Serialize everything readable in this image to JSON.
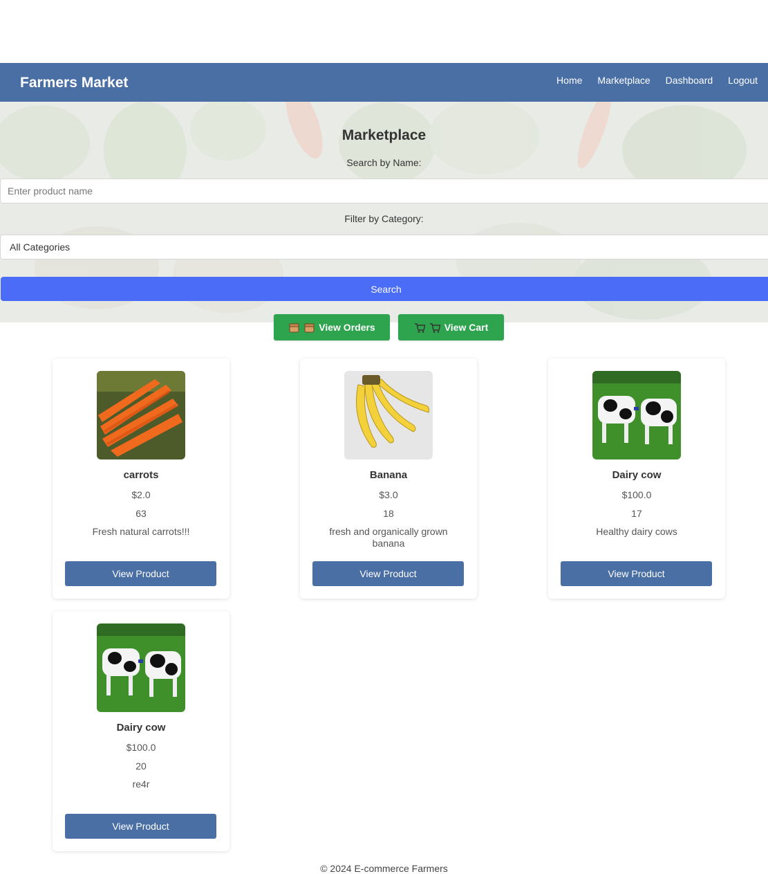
{
  "navbar": {
    "brand": "Farmers Market",
    "links": [
      "Home",
      "Marketplace",
      "Dashboard",
      "Logout"
    ]
  },
  "marketplace": {
    "title": "Marketplace",
    "search_label": "Search by Name:",
    "search_placeholder": "Enter product name",
    "category_label": "Filter by Category:",
    "category_selected": "All Categories",
    "search_button": "Search"
  },
  "actions": {
    "orders_label": "View Orders",
    "orders_icon": "box-icon",
    "cart_label": "View Cart",
    "cart_icon": "cart-icon"
  },
  "products": [
    {
      "name": "carrots",
      "price": "$2.0",
      "quantity": "63",
      "description": "Fresh natural carrots!!!",
      "image": "carrots-image",
      "button": "View Product"
    },
    {
      "name": "Banana",
      "price": "$3.0",
      "quantity": "18",
      "description": "fresh and organically grown banana",
      "image": "banana-image",
      "button": "View Product"
    },
    {
      "name": "Dairy cow",
      "price": "$100.0",
      "quantity": "17",
      "description": "Healthy dairy cows",
      "image": "cow-image",
      "button": "View Product"
    },
    {
      "name": "Dairy cow",
      "price": "$100.0",
      "quantity": "20",
      "description": "re4r",
      "image": "cow-image",
      "button": "View Product"
    }
  ],
  "colors": {
    "navbar": "#4a6fa5",
    "search_button": "#4a6cf7",
    "action_button": "#2ea44f"
  },
  "footer": "© 2024 E-commerce Farmers"
}
